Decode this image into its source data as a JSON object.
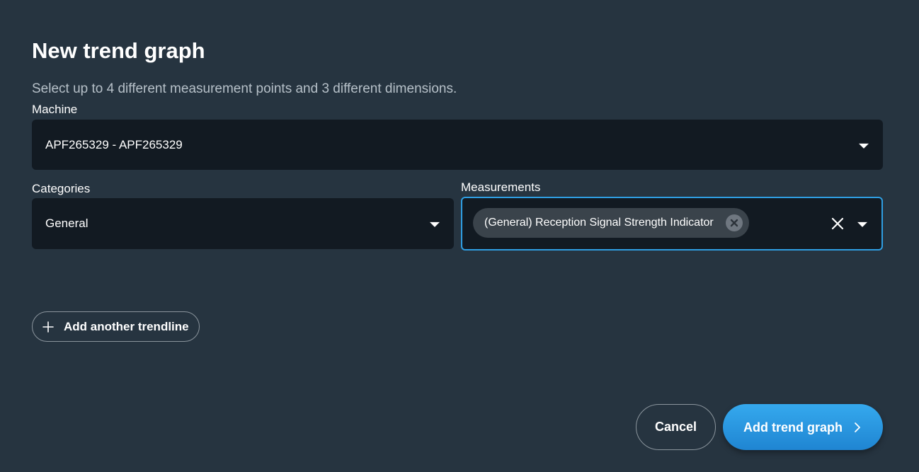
{
  "dialog": {
    "title": "New trend graph",
    "subtitle": "Select up to 4 different measurement points and 3 different dimensions."
  },
  "machine": {
    "label": "Machine",
    "value": "APF265329 - APF265329",
    "icon": "chevron-down-icon"
  },
  "categories": {
    "label": "Categories",
    "value": "General",
    "icon": "chevron-down-icon"
  },
  "measurements": {
    "label": "Measurements",
    "chips": [
      {
        "label": "(General) Reception Signal Strength Indicator",
        "remove_icon": "close-circle-icon"
      }
    ],
    "clear_icon": "close-icon",
    "icon": "chevron-down-icon"
  },
  "actions": {
    "add_trendline": {
      "label": "Add another trendline",
      "icon": "plus-icon"
    },
    "cancel": {
      "label": "Cancel"
    },
    "submit": {
      "label": "Add trend graph",
      "icon": "chevron-right-icon"
    }
  },
  "colors": {
    "background": "#263440",
    "field_background": "#121a22",
    "accent": "#2f9fe3",
    "chip_background": "#3a434b"
  }
}
